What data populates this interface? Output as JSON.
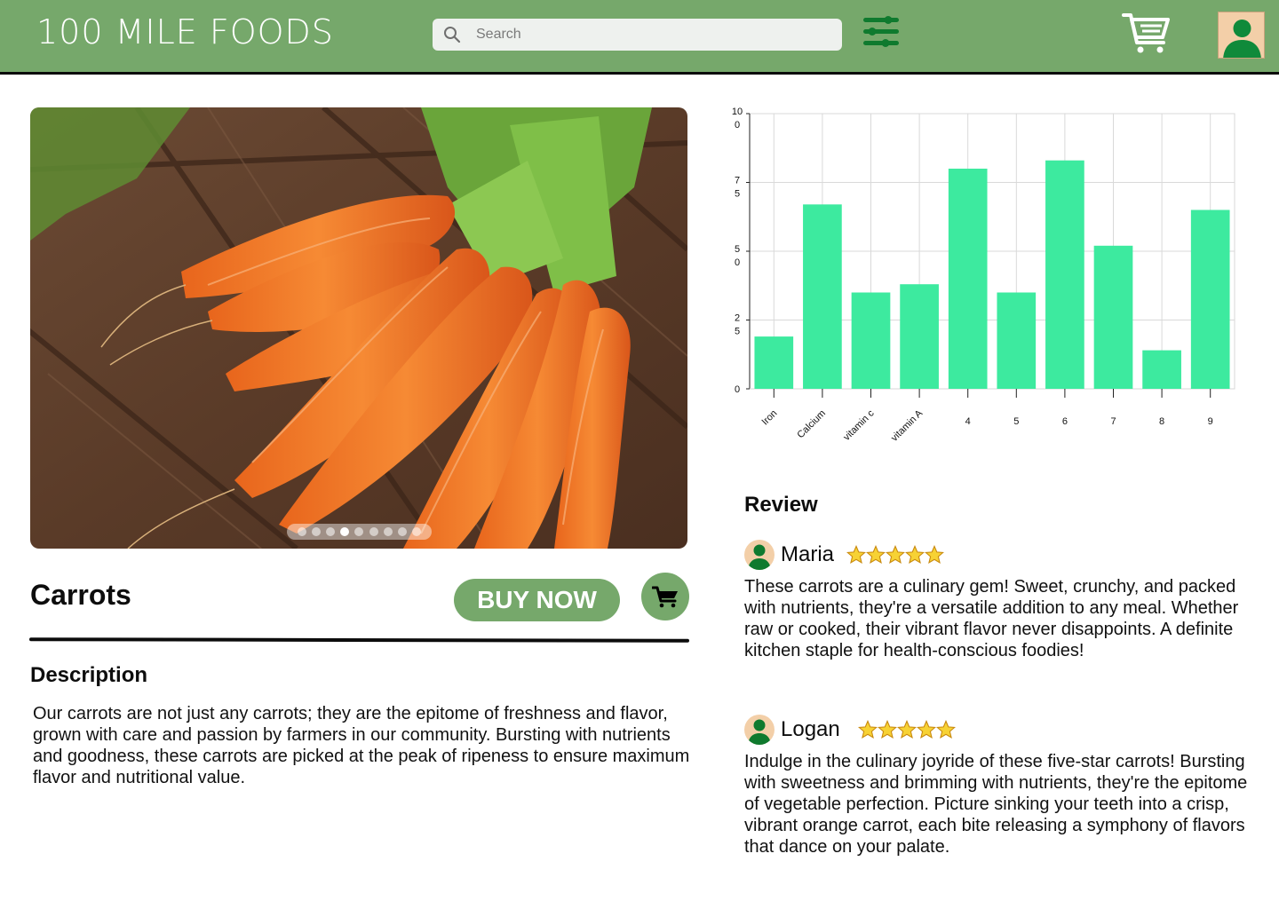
{
  "header": {
    "logo": "100 MILE FOODS",
    "search_placeholder": "Search"
  },
  "product": {
    "title": "Carrots",
    "buy_label": "BUY NOW",
    "carousel": {
      "dot_count": 9,
      "active_index": 3
    },
    "description_heading": "Description",
    "description": "Our carrots are not just any carrots; they are the epitome of freshness and flavor, grown with care and passion by farmers in our community. Bursting with nutrients and goodness, these carrots are picked at the peak of ripeness to ensure maximum flavor and nutritional value."
  },
  "colors": {
    "brand_green": "#76a86b",
    "bar_color": "#3dea9f"
  },
  "chart_data": {
    "type": "bar",
    "categories": [
      "Iron",
      "Calcium",
      "vitamin c",
      "vitamin A",
      "4",
      "5",
      "6",
      "7",
      "8",
      "9"
    ],
    "values": [
      19,
      67,
      35,
      38,
      80,
      35,
      83,
      52,
      14,
      65
    ],
    "ylim": [
      0,
      100
    ],
    "yticks": [
      "0",
      "25",
      "50",
      "75",
      "100"
    ],
    "grid": true,
    "title": "",
    "xlabel": "",
    "ylabel": ""
  },
  "reviews": {
    "heading": "Review",
    "items": [
      {
        "name": "Maria",
        "rating": 5,
        "text": "These carrots are a culinary gem! Sweet, crunchy, and packed with nutrients, they're a versatile addition to any meal. Whether raw or cooked, their vibrant flavor never disappoints. A definite kitchen staple for health-conscious foodies!"
      },
      {
        "name": "Logan",
        "rating": 5,
        "text": "Indulge in the culinary joyride of these five-star carrots! Bursting with sweetness and brimming with nutrients, they're the epitome of vegetable perfection. Picture sinking your teeth into a crisp, vibrant orange carrot, each bite releasing a symphony of flavors that dance on your palate."
      }
    ]
  }
}
